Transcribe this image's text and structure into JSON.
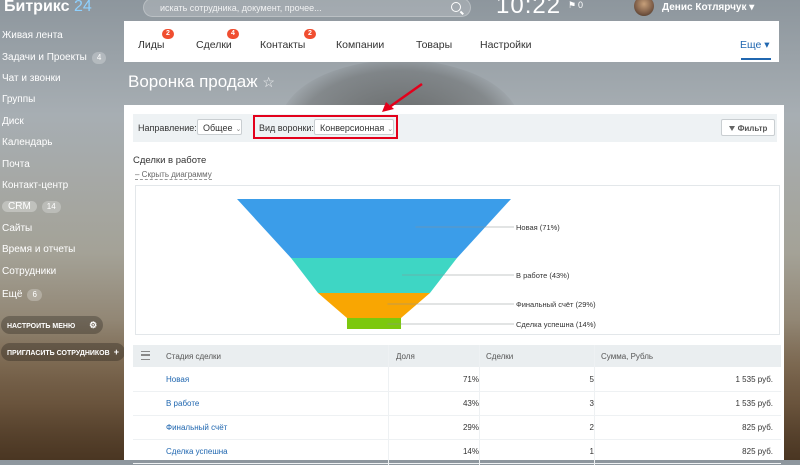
{
  "app": {
    "logo_text": "Битрикс",
    "logo_num": "24",
    "clock": "10:22",
    "flag_count": "0",
    "user_name": "Денис Котлярчук ▾"
  },
  "search": {
    "placeholder": "искать сотрудника, документ, прочее..."
  },
  "sidebar": {
    "items": [
      {
        "label": "Живая лента",
        "badge": ""
      },
      {
        "label": "Задачи и Проекты",
        "badge": "4"
      },
      {
        "label": "Чат и звонки",
        "badge": ""
      },
      {
        "label": "Группы",
        "badge": ""
      },
      {
        "label": "Диск",
        "badge": ""
      },
      {
        "label": "Календарь",
        "badge": ""
      },
      {
        "label": "Почта",
        "badge": ""
      },
      {
        "label": "Контакт-центр",
        "badge": ""
      },
      {
        "label": "CRM",
        "badge": "14"
      },
      {
        "label": "Сайты",
        "badge": ""
      },
      {
        "label": "Время и отчеты",
        "badge": ""
      },
      {
        "label": "Сотрудники",
        "badge": ""
      },
      {
        "label": "Ещё",
        "badge": "6"
      }
    ],
    "settings_button": "НАСТРОИТЬ МЕНЮ",
    "invite_button": "ПРИГЛАСИТЬ СОТРУДНИКОВ"
  },
  "nav": {
    "tabs": [
      {
        "label": "Лиды",
        "badge": "2"
      },
      {
        "label": "Сделки",
        "badge": "4"
      },
      {
        "label": "Контакты",
        "badge": "2"
      },
      {
        "label": "Компании",
        "badge": ""
      },
      {
        "label": "Товары",
        "badge": ""
      },
      {
        "label": "Настройки",
        "badge": ""
      }
    ],
    "more": "Еще ▾"
  },
  "page": {
    "title": "Воронка продаж",
    "star": "☆"
  },
  "filters": {
    "direction_label": "Направление:",
    "direction_value": "Общее",
    "funnel_type_label": "Вид воронки:",
    "funnel_type_value": "Конверсионная",
    "filter_button": "Фильтр",
    "arrow": "⌄"
  },
  "section": {
    "title": "Сделки в работе",
    "hide_link": "– Скрыть диаграмму"
  },
  "chart_data": {
    "type": "funnel",
    "stages": [
      {
        "name": "Новая",
        "percent": 71,
        "label": "Новая (71%)",
        "color": "#3b9de9"
      },
      {
        "name": "В работе",
        "percent": 43,
        "label": "В работе (43%)",
        "color": "#3ed6c4"
      },
      {
        "name": "Финальный счёт",
        "percent": 29,
        "label": "Финальный счёт (29%)",
        "color": "#f9a602"
      },
      {
        "name": "Сделка успешна",
        "percent": 14,
        "label": "Сделка успешна (14%)",
        "color": "#7cc80e"
      }
    ]
  },
  "table": {
    "headers": [
      "Стадия сделки",
      "Доля",
      "Сделки",
      "Сумма, Рубль"
    ],
    "rows": [
      {
        "stage": "Новая",
        "share": "71%",
        "deals": "5",
        "sum": "1 535 руб."
      },
      {
        "stage": "В работе",
        "share": "43%",
        "deals": "3",
        "sum": "1 535 руб."
      },
      {
        "stage": "Финальный счёт",
        "share": "29%",
        "deals": "2",
        "sum": "825 руб."
      },
      {
        "stage": "Сделка успешна",
        "share": "14%",
        "deals": "1",
        "sum": "825 руб."
      }
    ]
  },
  "colors": {
    "accent": "#2067b0",
    "badge": "#f04e30",
    "highlight_box": "#e3001b"
  }
}
